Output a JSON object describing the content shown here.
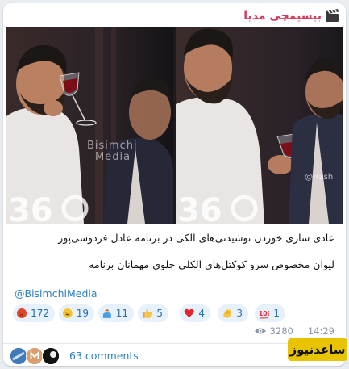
{
  "channel": {
    "name": "بیسیمچی مدیا"
  },
  "media": {
    "watermark_text_1": "Bisimchi",
    "watermark_text_2": "Media",
    "watermark_handle": "@Hash"
  },
  "post": {
    "caption_line_1": "عادی سازی خوردن نوشیدنی‌های الکی در برنامه عادل فردوسی‌پور",
    "caption_line_2": "لیوان مخصوص سرو کوکتل‌های الکلی جلوی مهمانان برنامه",
    "mention": "@BisimchiMedia"
  },
  "reactions": [
    {
      "icon": "angry-face-icon",
      "count": "172"
    },
    {
      "icon": "grinning-face-icon",
      "count": "19"
    },
    {
      "icon": "person-shrugging-icon",
      "count": "11"
    },
    {
      "icon": "thumbs-up-icon",
      "count": "5"
    },
    {
      "icon": "red-heart-icon",
      "count": "4"
    },
    {
      "icon": "clapping-hands-icon",
      "count": "3"
    },
    {
      "icon": "hundred-points-icon",
      "count": "1"
    }
  ],
  "meta": {
    "views": "3280",
    "time": "14:29"
  },
  "footer": {
    "comments_label": "63 comments"
  },
  "site_logo": {
    "text": "ساعدنیوز"
  },
  "colors": {
    "channel_name": "#d33b5d",
    "link": "#2b7fc2",
    "reaction_bg": "#e7f1fb",
    "logo_bg": "#e8c400"
  }
}
